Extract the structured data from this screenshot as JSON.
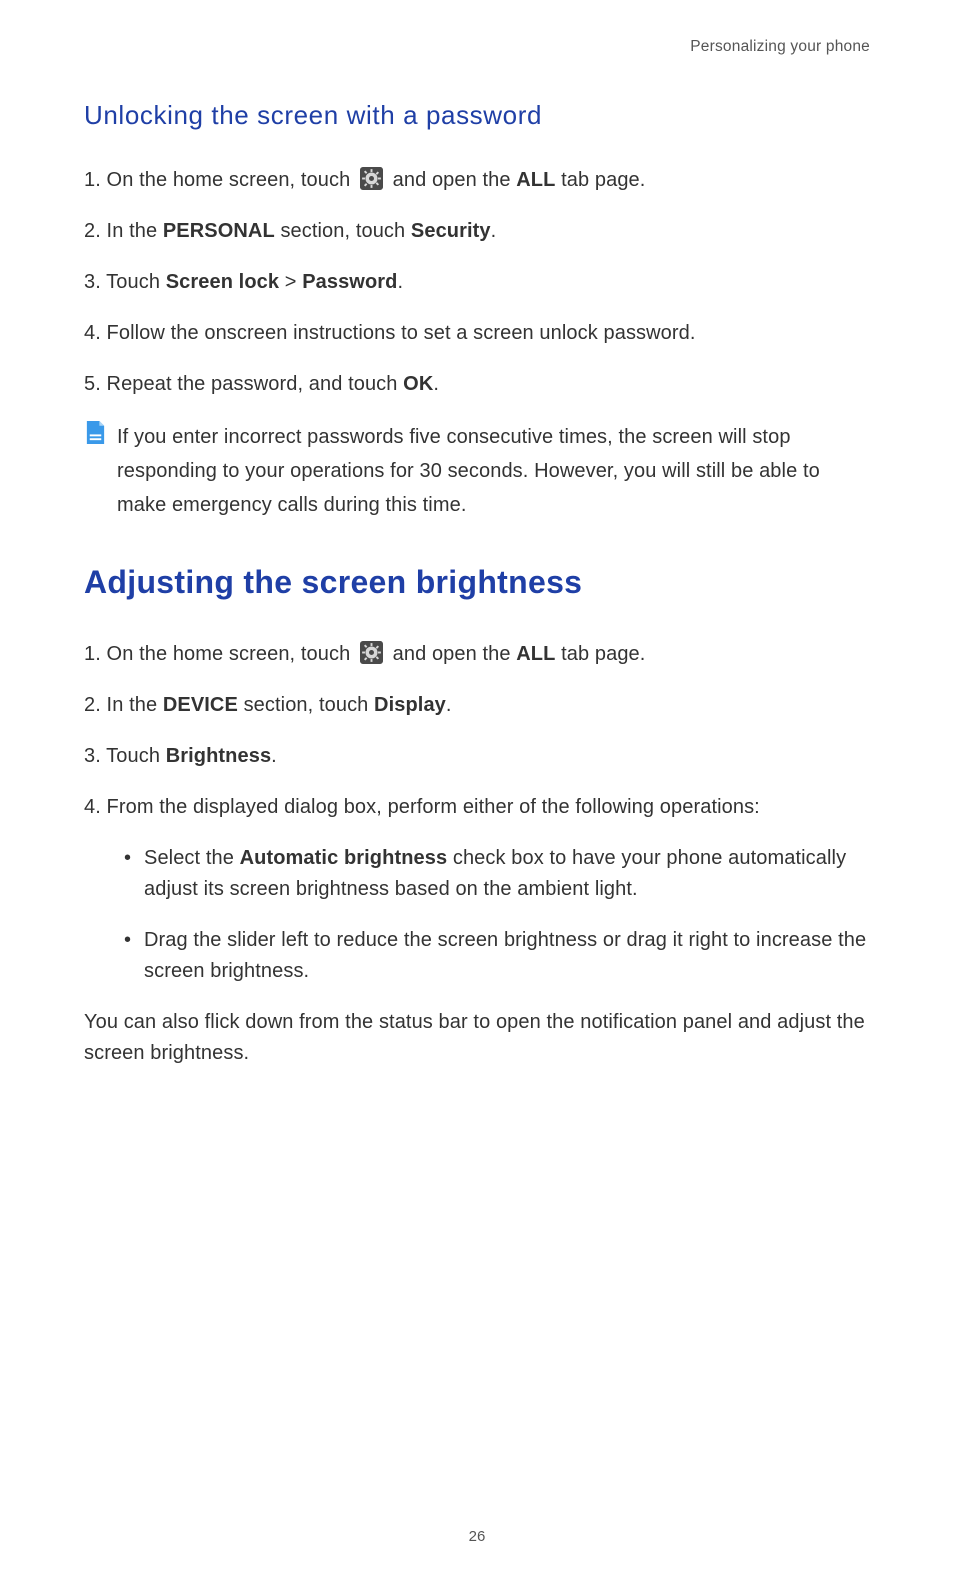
{
  "running_head": "Personalizing your phone",
  "section1": {
    "heading": "Unlocking the screen with a password",
    "steps": {
      "s1_a": "1. On the home screen, touch ",
      "s1_b": " and open the ",
      "s1_bold": "ALL",
      "s1_c": " tab page.",
      "s2_a": "2. In the ",
      "s2_b1": "PERSONAL",
      "s2_c": " section, touch ",
      "s2_b2": "Security",
      "s2_d": ".",
      "s3_a": "3. Touch ",
      "s3_b1": "Screen lock",
      "s3_mid": " > ",
      "s3_b2": "Password",
      "s3_d": ".",
      "s4": "4. Follow the onscreen instructions to set a screen unlock password.",
      "s5_a": "5. Repeat the password, and touch ",
      "s5_b": "OK",
      "s5_c": "."
    },
    "note": "If you enter incorrect passwords five consecutive times, the screen will stop responding to your operations for 30 seconds. However, you will still be able to make emergency calls during this time."
  },
  "section2": {
    "heading": "Adjusting the screen brightness",
    "steps": {
      "s1_a": "1. On the home screen, touch ",
      "s1_b": " and open the ",
      "s1_bold": "ALL",
      "s1_c": " tab page.",
      "s2_a": "2. In the ",
      "s2_b1": "DEVICE",
      "s2_c": " section, touch ",
      "s2_b2": "Display",
      "s2_d": ".",
      "s3_a": "3. Touch ",
      "s3_b": "Brightness",
      "s3_c": ".",
      "s4": "4. From the displayed dialog box, perform either of the following operations:"
    },
    "sub": {
      "i1_a": "Select the ",
      "i1_b": "Automatic brightness",
      "i1_c": " check box to have your phone automatically adjust its screen brightness based on the ambient light.",
      "i2": "Drag the slider left to reduce the screen brightness or drag it right to increase the screen brightness."
    },
    "tail": "You can also flick down from the status bar to open the notification panel and adjust the screen brightness."
  },
  "page_number": "26"
}
